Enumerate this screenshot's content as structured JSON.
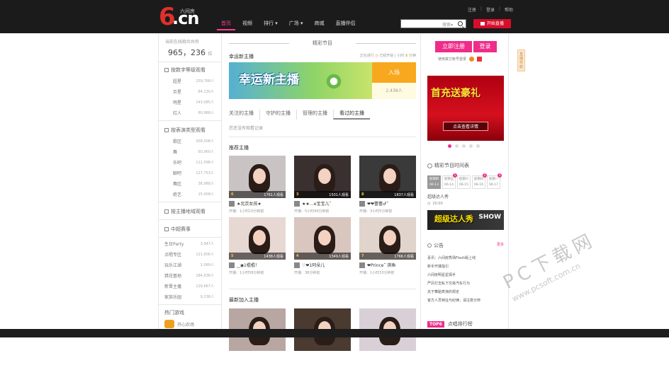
{
  "header": {
    "logo_main": "6",
    "logo_cn": ".cn",
    "logo_sub": "六间房",
    "nav": [
      "首页",
      "视频",
      "排行",
      "广场",
      "商城",
      "直播伴侣"
    ],
    "top_links": [
      "注册",
      "登录",
      "帮助"
    ],
    "search_type": "搜索",
    "live_button": "开始直播"
  },
  "left": {
    "online_label": "当前在线观众共有",
    "online_count": "965，236",
    "online_unit": "位",
    "sections": [
      {
        "title": "按数字等级观看",
        "rows": [
          {
            "name": "超星",
            "value": "259,768人"
          },
          {
            "name": "巨星",
            "value": "84,130人"
          },
          {
            "name": "明星",
            "value": "143,085人"
          },
          {
            "name": "红人",
            "value": "80,988人"
          }
        ]
      },
      {
        "title": "按表演类型观看",
        "rows": [
          {
            "name": "歌区",
            "value": "309,008人"
          },
          {
            "name": "舞",
            "value": "60,960人"
          },
          {
            "name": "乐吧",
            "value": "111,598人"
          },
          {
            "name": "聊吧",
            "value": "127,753人"
          },
          {
            "name": "舞区",
            "value": "36,988人"
          },
          {
            "name": "绝艺",
            "value": "15,408人"
          }
        ]
      }
    ],
    "region_title": "按主播地域观看",
    "events_title": "中超赛事",
    "events": [
      {
        "name": "生日Party",
        "value": "3,947人"
      },
      {
        "name": "点唱专区",
        "value": "121,606人"
      },
      {
        "name": "玩乐江湖",
        "value": "1,069人"
      },
      {
        "name": "猎花基地",
        "value": "184,038人"
      },
      {
        "name": "新晋主播",
        "value": "129,667人"
      },
      {
        "name": "家族乐园",
        "value": "9,238人"
      }
    ],
    "hot_title": "热门游戏",
    "hot_item": "开心农场"
  },
  "center": {
    "section_title": "精彩节目",
    "lucky_title": "幸运新主播",
    "lucky_status_pre": "正在进行",
    "lucky_status_started": "已经开始",
    "lucky_status_elapsed": "小时",
    "lucky_status_minutes": "分钟",
    "lucky_banner_text": "幸运新主播",
    "lucky_enter": "入场",
    "lucky_viewers": "2,438人",
    "tabs": [
      "关注的主播",
      "守护的主播",
      "管理的主播",
      "看过的主播"
    ],
    "tab_empty": "您还没有观看记录",
    "recommend_title": "推荐主播",
    "anchors": [
      {
        "level": "6",
        "viewers": "1761人观看",
        "name": "★北京女孩★",
        "meta": "开播：1小时10分钟前",
        "bg": "#c9c4c3"
      },
      {
        "level": "3",
        "viewers": "1501人观看",
        "name": "★★…e宝宝儿˜",
        "meta": "开播：5小时40分钟前",
        "bg": "#3a3030"
      },
      {
        "level": "8",
        "viewers": "1837人观看",
        "name": "❤❤蕾蕾♂˜",
        "meta": "开播：3小时5分钟前",
        "bg": "#3a3a3a"
      },
      {
        "level": "5",
        "viewers": "1438人观看",
        "name": "‿◉1棍棍！",
        "meta": "开播：1小时58分钟前",
        "bg": "#e8d8d4"
      },
      {
        "level": "4",
        "viewers": "1349人观看",
        "name": "♡❤1阿朵儿",
        "meta": "开播：38分钟前",
        "bg": "#d8c6bf"
      },
      {
        "level": "7",
        "viewers": "1766人观看",
        "name": "❤Prince˜ 琪鱼",
        "meta": "开播：1小时33分钟前",
        "bg": "#e0d4cc"
      }
    ],
    "newest_title": "最新加入主播"
  },
  "right": {
    "register": "立即注册",
    "login": "登录",
    "other_login": "使用其它帐号登录",
    "promo_title": "首充送豪礼",
    "promo_button": "点击查看详情",
    "schedule_title": "精彩节目时间表",
    "days": [
      {
        "name": "星期四",
        "date": "06-13",
        "mark": ""
      },
      {
        "name": "星期五",
        "date": "06-14",
        "mark": "1"
      },
      {
        "name": "星期六",
        "date": "06-15",
        "mark": ""
      },
      {
        "name": "星期日",
        "date": "06-16",
        "mark": "2"
      },
      {
        "name": "星期一",
        "date": "06-17",
        "mark": "3"
      }
    ],
    "program_name": "超级达人秀",
    "program_time": "20:00",
    "program_img_title": "超级达人秀",
    "program_img_side": "SHOW",
    "notice_title": "公告",
    "notice_more": "更多",
    "notices": [
      "喜讯：六间房秀场Flash版上线",
      "新手开播指引",
      "六间房明星星探手",
      "严厉打击私下交易汽车行为",
      "关于舞蹈表演的规定",
      "官方人员特征与纪律，请注意分辨"
    ],
    "top6_badge": "TOP6",
    "top6_title": "点唱排行榜"
  },
  "side_tag": "直播导航",
  "watermark": {
    "big": "PC下载网",
    "small": "www.pcsoft.com.cn"
  },
  "colors": {
    "brand_pink": "#ee2d8a",
    "brand_red": "#d70e2b",
    "topbar": "#1b1b1b"
  }
}
